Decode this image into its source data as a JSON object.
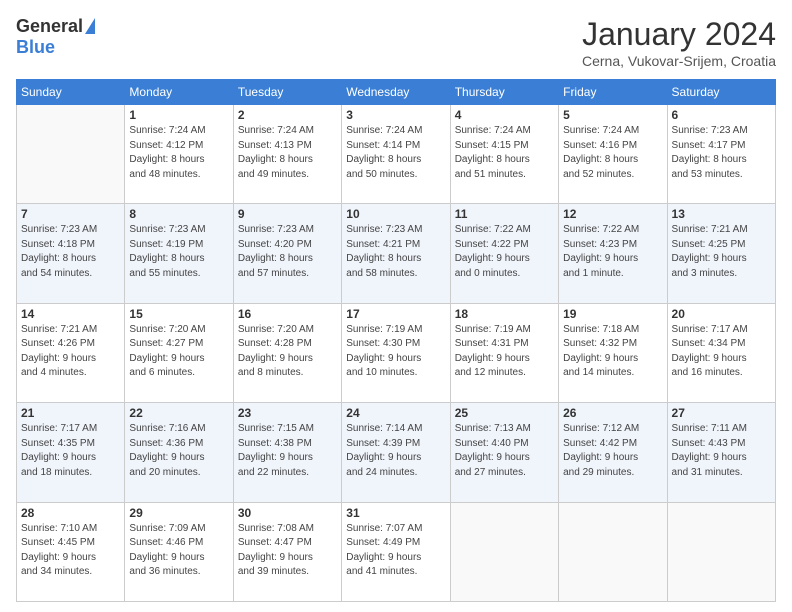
{
  "logo": {
    "general": "General",
    "blue": "Blue"
  },
  "title": "January 2024",
  "subtitle": "Cerna, Vukovar-Srijem, Croatia",
  "days_of_week": [
    "Sunday",
    "Monday",
    "Tuesday",
    "Wednesday",
    "Thursday",
    "Friday",
    "Saturday"
  ],
  "weeks": [
    [
      {
        "day": "",
        "info": ""
      },
      {
        "day": "1",
        "info": "Sunrise: 7:24 AM\nSunset: 4:12 PM\nDaylight: 8 hours\nand 48 minutes."
      },
      {
        "day": "2",
        "info": "Sunrise: 7:24 AM\nSunset: 4:13 PM\nDaylight: 8 hours\nand 49 minutes."
      },
      {
        "day": "3",
        "info": "Sunrise: 7:24 AM\nSunset: 4:14 PM\nDaylight: 8 hours\nand 50 minutes."
      },
      {
        "day": "4",
        "info": "Sunrise: 7:24 AM\nSunset: 4:15 PM\nDaylight: 8 hours\nand 51 minutes."
      },
      {
        "day": "5",
        "info": "Sunrise: 7:24 AM\nSunset: 4:16 PM\nDaylight: 8 hours\nand 52 minutes."
      },
      {
        "day": "6",
        "info": "Sunrise: 7:23 AM\nSunset: 4:17 PM\nDaylight: 8 hours\nand 53 minutes."
      }
    ],
    [
      {
        "day": "7",
        "info": "Sunrise: 7:23 AM\nSunset: 4:18 PM\nDaylight: 8 hours\nand 54 minutes."
      },
      {
        "day": "8",
        "info": "Sunrise: 7:23 AM\nSunset: 4:19 PM\nDaylight: 8 hours\nand 55 minutes."
      },
      {
        "day": "9",
        "info": "Sunrise: 7:23 AM\nSunset: 4:20 PM\nDaylight: 8 hours\nand 57 minutes."
      },
      {
        "day": "10",
        "info": "Sunrise: 7:23 AM\nSunset: 4:21 PM\nDaylight: 8 hours\nand 58 minutes."
      },
      {
        "day": "11",
        "info": "Sunrise: 7:22 AM\nSunset: 4:22 PM\nDaylight: 9 hours\nand 0 minutes."
      },
      {
        "day": "12",
        "info": "Sunrise: 7:22 AM\nSunset: 4:23 PM\nDaylight: 9 hours\nand 1 minute."
      },
      {
        "day": "13",
        "info": "Sunrise: 7:21 AM\nSunset: 4:25 PM\nDaylight: 9 hours\nand 3 minutes."
      }
    ],
    [
      {
        "day": "14",
        "info": "Sunrise: 7:21 AM\nSunset: 4:26 PM\nDaylight: 9 hours\nand 4 minutes."
      },
      {
        "day": "15",
        "info": "Sunrise: 7:20 AM\nSunset: 4:27 PM\nDaylight: 9 hours\nand 6 minutes."
      },
      {
        "day": "16",
        "info": "Sunrise: 7:20 AM\nSunset: 4:28 PM\nDaylight: 9 hours\nand 8 minutes."
      },
      {
        "day": "17",
        "info": "Sunrise: 7:19 AM\nSunset: 4:30 PM\nDaylight: 9 hours\nand 10 minutes."
      },
      {
        "day": "18",
        "info": "Sunrise: 7:19 AM\nSunset: 4:31 PM\nDaylight: 9 hours\nand 12 minutes."
      },
      {
        "day": "19",
        "info": "Sunrise: 7:18 AM\nSunset: 4:32 PM\nDaylight: 9 hours\nand 14 minutes."
      },
      {
        "day": "20",
        "info": "Sunrise: 7:17 AM\nSunset: 4:34 PM\nDaylight: 9 hours\nand 16 minutes."
      }
    ],
    [
      {
        "day": "21",
        "info": "Sunrise: 7:17 AM\nSunset: 4:35 PM\nDaylight: 9 hours\nand 18 minutes."
      },
      {
        "day": "22",
        "info": "Sunrise: 7:16 AM\nSunset: 4:36 PM\nDaylight: 9 hours\nand 20 minutes."
      },
      {
        "day": "23",
        "info": "Sunrise: 7:15 AM\nSunset: 4:38 PM\nDaylight: 9 hours\nand 22 minutes."
      },
      {
        "day": "24",
        "info": "Sunrise: 7:14 AM\nSunset: 4:39 PM\nDaylight: 9 hours\nand 24 minutes."
      },
      {
        "day": "25",
        "info": "Sunrise: 7:13 AM\nSunset: 4:40 PM\nDaylight: 9 hours\nand 27 minutes."
      },
      {
        "day": "26",
        "info": "Sunrise: 7:12 AM\nSunset: 4:42 PM\nDaylight: 9 hours\nand 29 minutes."
      },
      {
        "day": "27",
        "info": "Sunrise: 7:11 AM\nSunset: 4:43 PM\nDaylight: 9 hours\nand 31 minutes."
      }
    ],
    [
      {
        "day": "28",
        "info": "Sunrise: 7:10 AM\nSunset: 4:45 PM\nDaylight: 9 hours\nand 34 minutes."
      },
      {
        "day": "29",
        "info": "Sunrise: 7:09 AM\nSunset: 4:46 PM\nDaylight: 9 hours\nand 36 minutes."
      },
      {
        "day": "30",
        "info": "Sunrise: 7:08 AM\nSunset: 4:47 PM\nDaylight: 9 hours\nand 39 minutes."
      },
      {
        "day": "31",
        "info": "Sunrise: 7:07 AM\nSunset: 4:49 PM\nDaylight: 9 hours\nand 41 minutes."
      },
      {
        "day": "",
        "info": ""
      },
      {
        "day": "",
        "info": ""
      },
      {
        "day": "",
        "info": ""
      }
    ]
  ]
}
